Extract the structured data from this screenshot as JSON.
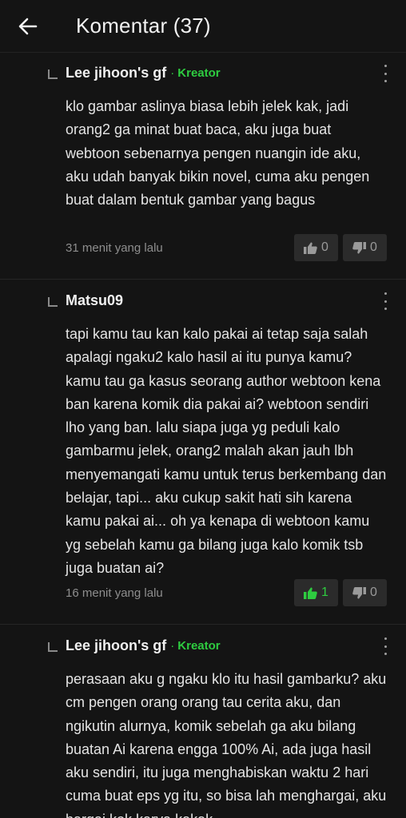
{
  "header": {
    "back_icon": "arrow-left-icon",
    "title": "Komentar (37)"
  },
  "colors": {
    "background": "#141414",
    "accent": "#2ecc40",
    "vote_bg": "#2b2b2b"
  },
  "comments": [
    {
      "author": "Lee jihoon's gf",
      "badge_sep": "·",
      "badge": "Kreator",
      "text": "klo gambar aslinya biasa lebih jelek kak, jadi orang2 ga minat buat baca, aku juga buat webtoon sebenarnya pengen nuangin ide aku, aku udah banyak bikin novel, cuma aku pengen buat dalam bentuk gambar yang bagus",
      "time": "31 menit yang lalu",
      "likes": "0",
      "dislikes": "0",
      "liked": false
    },
    {
      "author": "Matsu09",
      "text": "tapi kamu tau kan kalo pakai ai tetap saja salah apalagi ngaku2 kalo hasil ai itu punya kamu? kamu tau ga kasus seorang author webtoon kena ban karena komik dia pakai ai? webtoon sendiri lho yang ban. lalu siapa juga yg peduli kalo gambarmu jelek, orang2 malah akan jauh lbh menyemangati kamu untuk terus berkembang dan belajar, tapi... aku cukup sakit hati sih karena kamu pakai ai... oh ya kenapa di webtoon kamu yg sebelah kamu ga bilang juga kalo komik tsb juga buatan ai?",
      "time": "16 menit yang lalu",
      "likes": "1",
      "dislikes": "0",
      "liked": true
    },
    {
      "author": "Lee jihoon's gf",
      "badge_sep": "·",
      "badge": "Kreator",
      "text": "perasaan aku g ngaku klo itu hasil gambarku? aku cm pengen orang orang tau cerita aku, dan ngikutin alurnya, komik sebelah ga aku bilang buatan Ai karena engga 100% Ai, ada juga hasil aku sendiri, itu juga menghabiskan waktu 2 hari cuma buat eps yg itu, so bisa lah menghargai, aku hargai kok karya kakak"
    }
  ]
}
